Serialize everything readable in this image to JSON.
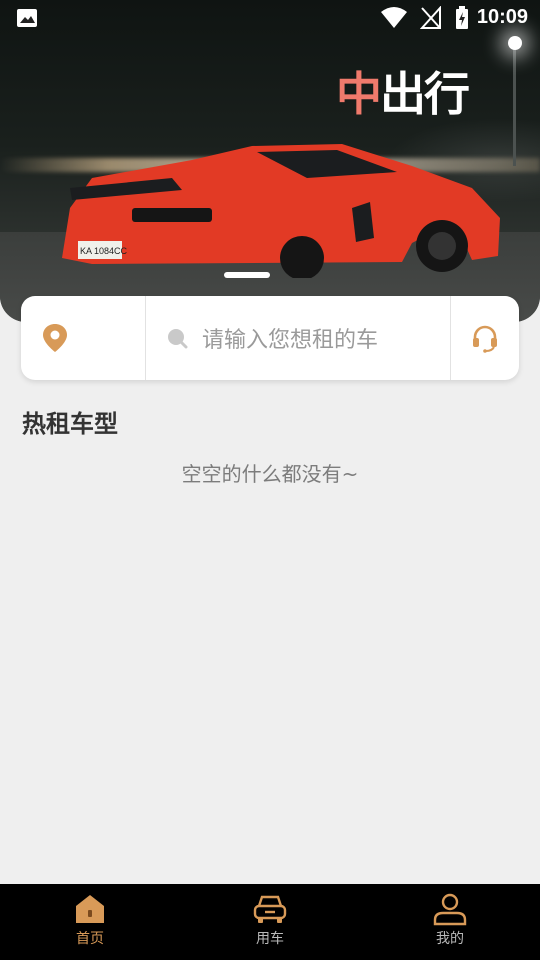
{
  "status_bar": {
    "time": "10:09"
  },
  "banner": {
    "logo_char1": "中",
    "logo_rest": "出行",
    "plate": "KA 1084CC"
  },
  "search": {
    "placeholder": "请输入您想租的车"
  },
  "section": {
    "title": "热租车型",
    "empty_text": "空空的什么都没有~"
  },
  "bottom_nav": {
    "items": [
      {
        "label": "首页",
        "icon": "home-icon",
        "active": true
      },
      {
        "label": "用车",
        "icon": "car-icon",
        "active": false
      },
      {
        "label": "我的",
        "icon": "profile-icon",
        "active": false
      }
    ]
  },
  "colors": {
    "accent": "#d89a58",
    "logo_red": "#f07a6c",
    "car_red": "#e23a25"
  }
}
